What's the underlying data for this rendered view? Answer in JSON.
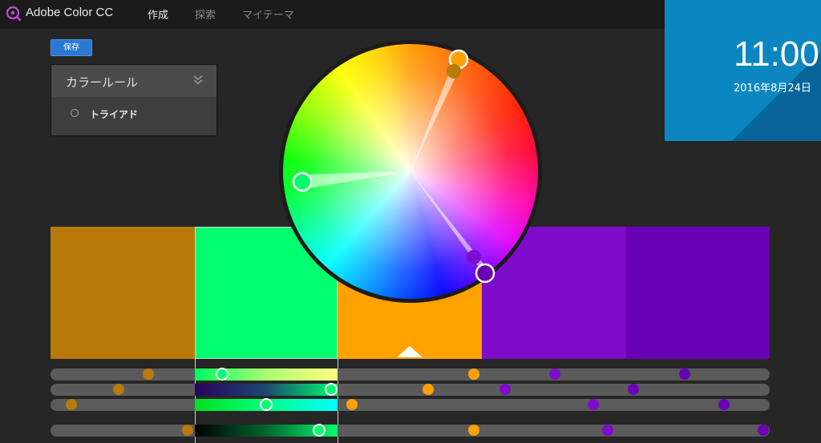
{
  "app": {
    "title": "Adobe Color CC"
  },
  "nav": [
    {
      "label": "作成",
      "active": true
    },
    {
      "label": "探索",
      "active": false
    },
    {
      "label": "マイテーマ",
      "active": false
    }
  ],
  "toolbar": {
    "save_label": "保存"
  },
  "rule_panel": {
    "title": "カラールール",
    "selected_rule": "トライアド"
  },
  "swatches": [
    {
      "color": "#b87a0a",
      "selected": false,
      "base": false
    },
    {
      "color": "#00ff6e",
      "selected": true,
      "base": false
    },
    {
      "color": "#ffa200",
      "selected": false,
      "base": true
    },
    {
      "color": "#7f0ccc",
      "selected": false,
      "base": false
    },
    {
      "color": "#6a00b6",
      "selected": false,
      "base": false
    }
  ],
  "clock": {
    "time": "11:00",
    "date": "2016年8月24日"
  },
  "colors": {
    "accent": "#2a79d3",
    "clock_bg": "#0c86c0"
  }
}
